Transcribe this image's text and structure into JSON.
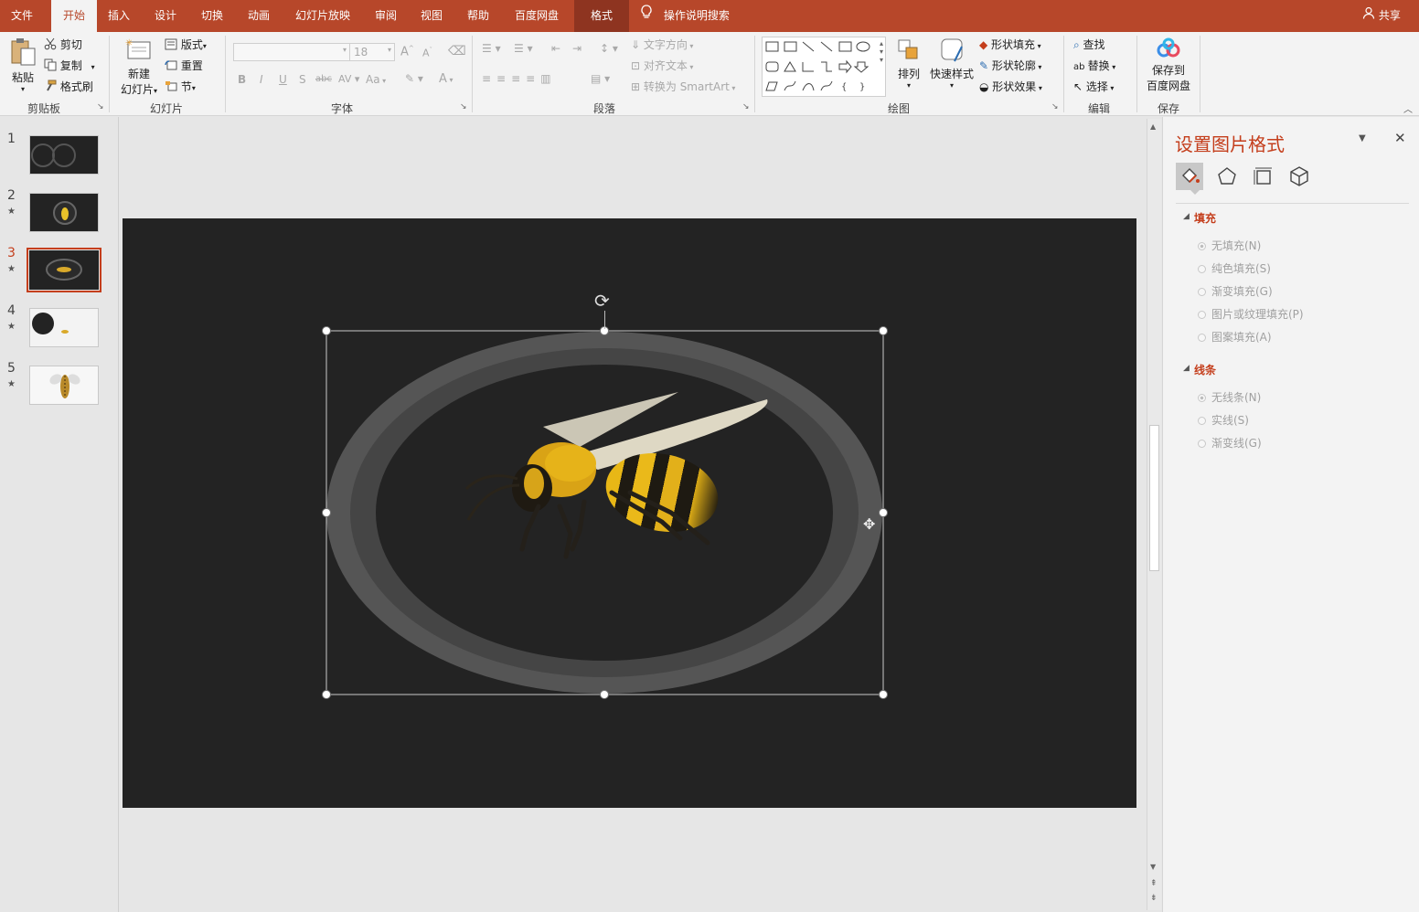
{
  "tabs": [
    "文件",
    "开始",
    "插入",
    "设计",
    "切换",
    "动画",
    "幻灯片放映",
    "审阅",
    "视图",
    "帮助",
    "百度网盘",
    "格式"
  ],
  "search_label": "操作说明搜索",
  "share_label": "共享",
  "clipboard": {
    "paste": "粘贴",
    "cut": "剪切",
    "copy": "复制",
    "format_painter": "格式刷",
    "group": "剪贴板"
  },
  "slides_group": {
    "new_slide_1": "新建",
    "new_slide_2": "幻灯片",
    "layout": "版式",
    "reset": "重置",
    "section": "节",
    "group": "幻灯片"
  },
  "font_group": {
    "size": "18",
    "group": "字体",
    "bold": "B",
    "italic": "I",
    "underline": "U",
    "shadow": "S",
    "strike": "abc",
    "case": "Aa"
  },
  "paragraph_group": {
    "text_direction": "文字方向",
    "align_text": "对齐文本",
    "smartart": "转换为 SmartArt",
    "group": "段落"
  },
  "drawing_group": {
    "arrange": "排列",
    "quick_styles": "快速样式",
    "shape_fill": "形状填充",
    "shape_outline": "形状轮廓",
    "shape_effects": "形状效果",
    "group": "绘图"
  },
  "editing_group": {
    "find": "查找",
    "replace": "替换",
    "select": "选择",
    "group": "编辑"
  },
  "save_group": {
    "save_1": "保存到",
    "save_2": "百度网盘",
    "group": "保存"
  },
  "thumbnails": [
    "1",
    "2",
    "3",
    "4",
    "5"
  ],
  "selected_slide": 3,
  "pane": {
    "title": "设置图片格式",
    "fill_section": "填充",
    "fill_options": [
      "无填充(N)",
      "纯色填充(S)",
      "渐变填充(G)",
      "图片或纹理填充(P)",
      "图案填充(A)"
    ],
    "line_section": "线条",
    "line_options": [
      "无线条(N)",
      "实线(S)",
      "渐变线(G)"
    ]
  },
  "colors": {
    "accent": "#b7472a",
    "accent_text": "#c43e1c",
    "slide_bg": "#232323"
  }
}
